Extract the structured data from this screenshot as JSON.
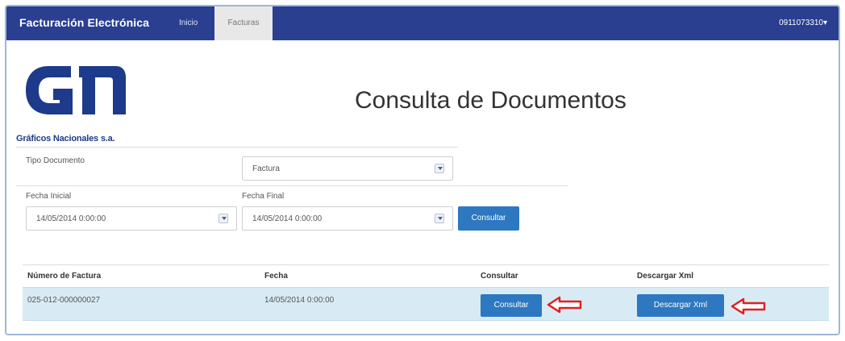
{
  "navbar": {
    "brand": "Facturación Electrónica",
    "items": [
      {
        "label": "Inicio"
      },
      {
        "label": "Facturas"
      }
    ],
    "user": "0911073310▾"
  },
  "logo": {
    "caption": "Gráficos Nacionales s.a."
  },
  "page": {
    "title": "Consulta de Documentos"
  },
  "form": {
    "tipo_documento": {
      "label": "Tipo Documento",
      "value": "Factura"
    },
    "fecha_inicial": {
      "label": "Fecha Inicial",
      "value": "14/05/2014 0:00:00"
    },
    "fecha_final": {
      "label": "Fecha Final",
      "value": "14/05/2014 0:00:00"
    },
    "consultar_label": "Consultar"
  },
  "table": {
    "headers": [
      "Número de Factura",
      "Fecha",
      "Consultar",
      "Descargar Xml"
    ],
    "rows": [
      {
        "numero": "025-012-000000027",
        "fecha": "14/05/2014 0:00:00",
        "consultar_label": "Consultar",
        "descargar_label": "Descargar Xml"
      }
    ]
  },
  "colors": {
    "navbar": "#2a3f8f",
    "button": "#2d78c0",
    "row_highlight": "#d8ebf5",
    "annotation_arrow": "#e02020"
  }
}
